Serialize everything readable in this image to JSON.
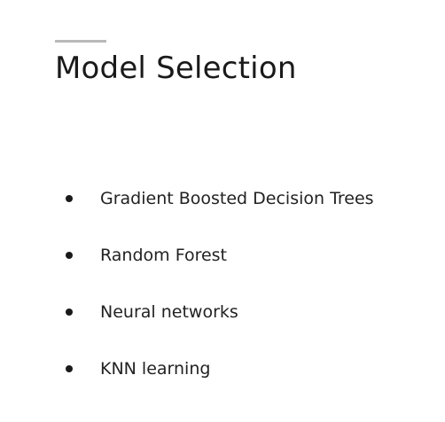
{
  "slide": {
    "title": "Model Selection",
    "bullets": [
      "Gradient Boosted Decision Trees",
      "Random Forest",
      "Neural networks",
      "KNN learning"
    ]
  }
}
